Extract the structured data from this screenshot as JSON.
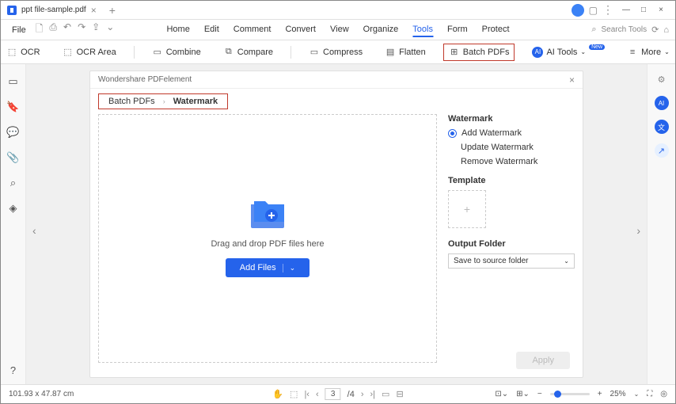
{
  "titlebar": {
    "tab_title": "ppt file-sample.pdf"
  },
  "menubar": {
    "file": "File",
    "items": [
      "Home",
      "Edit",
      "Comment",
      "Convert",
      "View",
      "Organize",
      "Tools",
      "Form",
      "Protect"
    ],
    "active_index": 6,
    "search_placeholder": "Search Tools"
  },
  "toolbar": {
    "ocr": "OCR",
    "ocr_area": "OCR Area",
    "combine": "Combine",
    "compare": "Compare",
    "compress": "Compress",
    "flatten": "Flatten",
    "batch_pdfs": "Batch PDFs",
    "ai_tools": "AI Tools",
    "new_badge": "New",
    "more": "More"
  },
  "panel": {
    "title": "Wondershare PDFelement",
    "breadcrumb_parent": "Batch PDFs",
    "breadcrumb_current": "Watermark",
    "drop_text": "Drag and drop PDF files here",
    "add_files": "Add Files",
    "apply": "Apply"
  },
  "watermark": {
    "heading": "Watermark",
    "add": "Add Watermark",
    "update": "Update Watermark",
    "remove": "Remove Watermark",
    "template": "Template",
    "output_folder": "Output Folder",
    "output_value": "Save to source folder"
  },
  "statusbar": {
    "coords": "101.93 x 47.87 cm",
    "page_current": "3",
    "page_total": "/4",
    "zoom": "25%"
  }
}
